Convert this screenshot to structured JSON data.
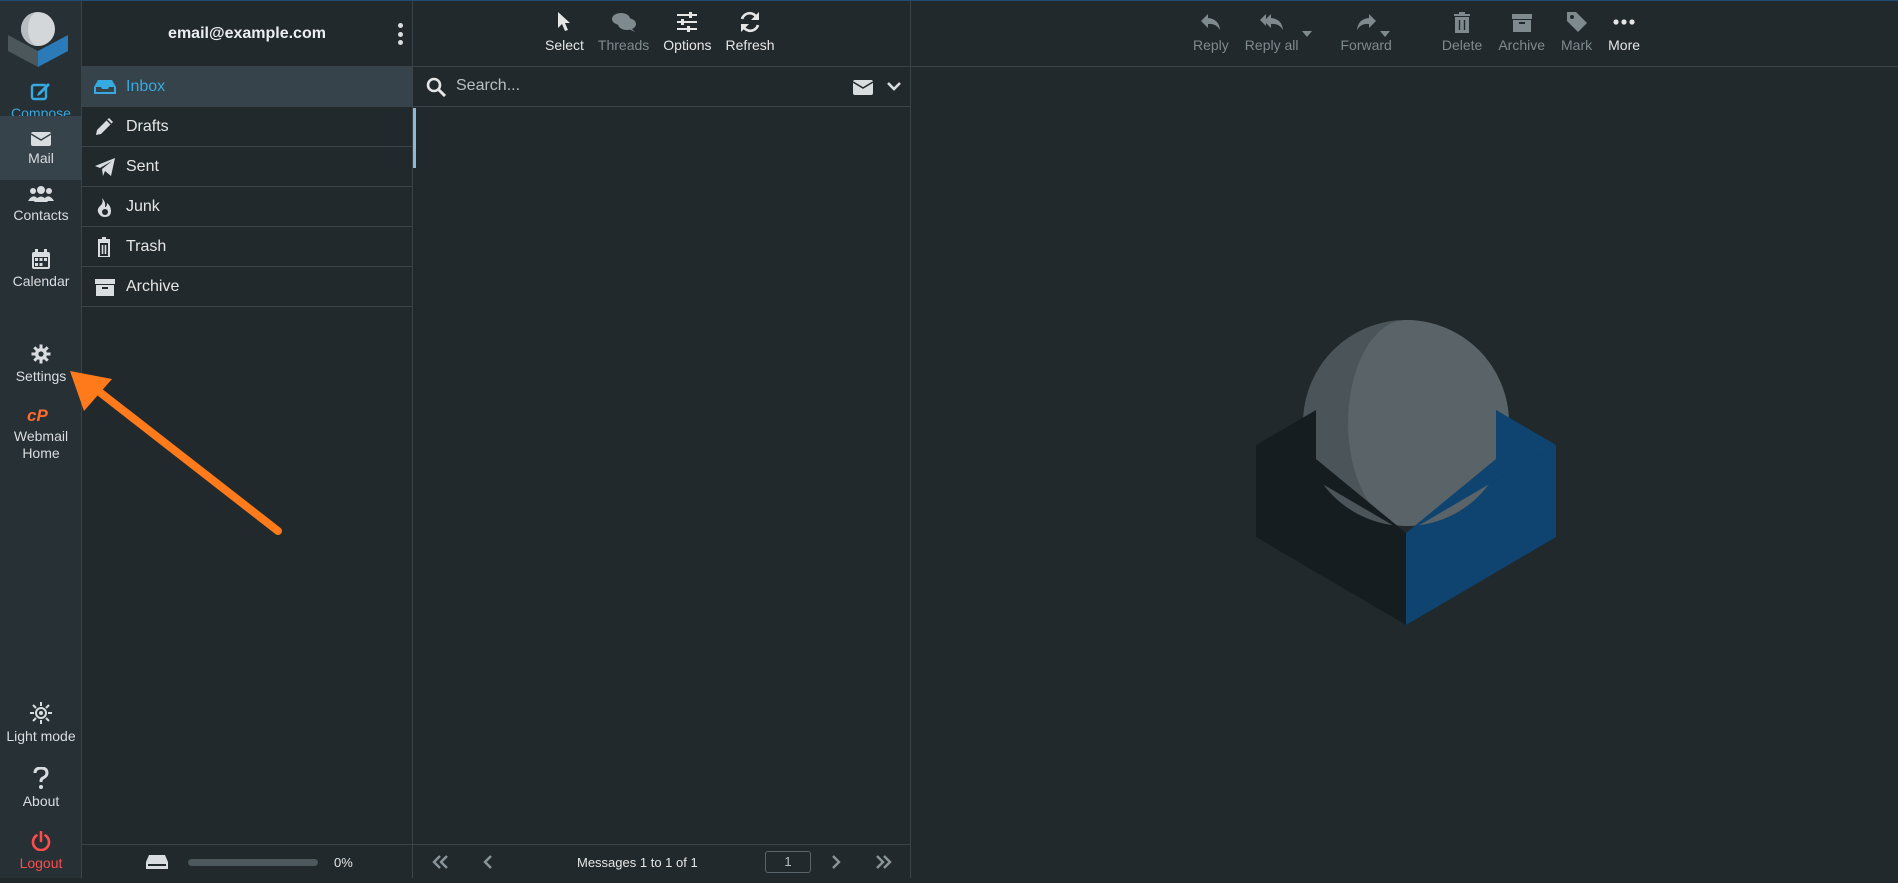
{
  "account": {
    "email": "email@example.com"
  },
  "nav": {
    "compose": "Compose",
    "mail": "Mail",
    "contacts": "Contacts",
    "calendar": "Calendar",
    "settings": "Settings",
    "webmail_home_1": "Webmail",
    "webmail_home_2": "Home",
    "light_mode": "Light mode",
    "about": "About",
    "logout": "Logout"
  },
  "folders": [
    {
      "label": "Inbox",
      "icon": "inbox-icon",
      "active": true
    },
    {
      "label": "Drafts",
      "icon": "pencil-icon"
    },
    {
      "label": "Sent",
      "icon": "paper-plane-icon"
    },
    {
      "label": "Junk",
      "icon": "fire-icon"
    },
    {
      "label": "Trash",
      "icon": "trash-icon"
    },
    {
      "label": "Archive",
      "icon": "archive-icon"
    }
  ],
  "quota": {
    "text": "0%",
    "fraction": 0
  },
  "list_toolbar": {
    "select": "Select",
    "threads": "Threads",
    "options": "Options",
    "refresh": "Refresh"
  },
  "search": {
    "placeholder": "Search..."
  },
  "list_footer": {
    "count": "Messages 1 to 1 of 1",
    "page": "1"
  },
  "preview_toolbar": {
    "reply": "Reply",
    "reply_all": "Reply all",
    "forward": "Forward",
    "delete": "Delete",
    "archive": "Archive",
    "mark": "Mark",
    "more": "More"
  },
  "colors": {
    "accent": "#37a9e1",
    "logout": "#ff4d4d",
    "arrow": "#ff7a1a",
    "logo_blue": "#0f4470"
  }
}
